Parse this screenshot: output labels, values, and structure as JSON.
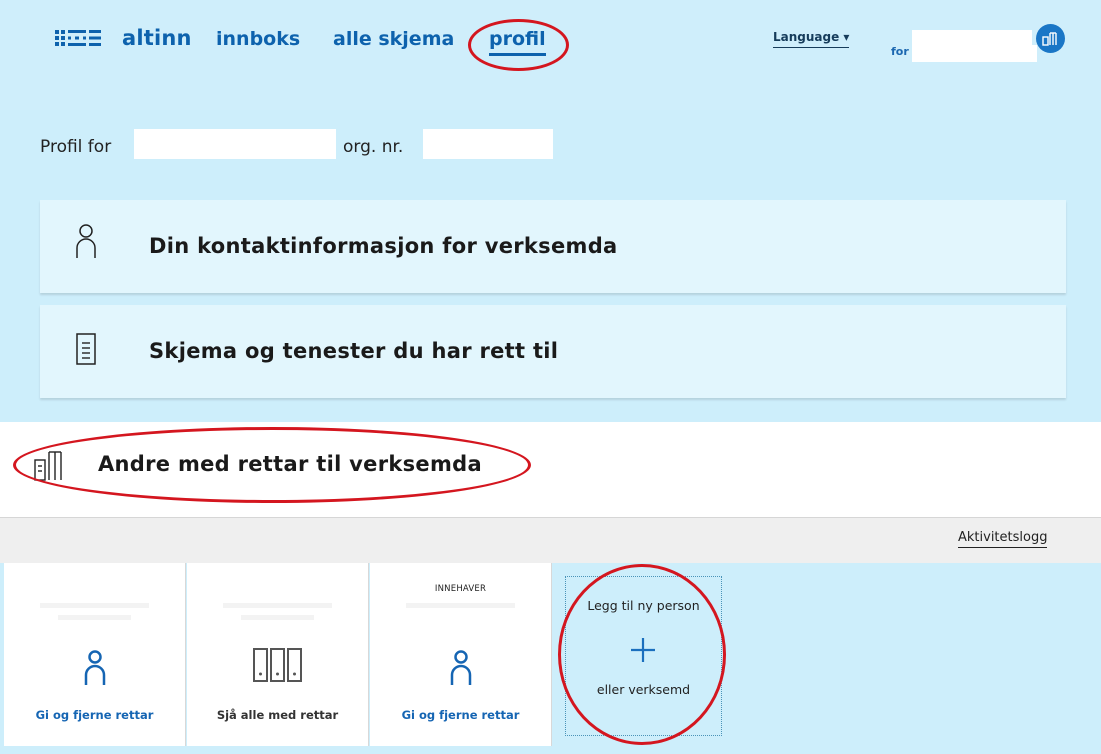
{
  "header": {
    "logo_text": "altinn",
    "nav": [
      {
        "label": "innboks"
      },
      {
        "label": "alle skjema"
      },
      {
        "label": "profil"
      }
    ],
    "language_label": "Language ▾",
    "for_label": "for"
  },
  "profile": {
    "prefix": "Profil for",
    "org_label": "org. nr."
  },
  "cards": [
    {
      "label": "Din kontaktinformasjon for verksemda",
      "icon": "person-icon"
    },
    {
      "label": "Skjema og tenester du har rett til",
      "icon": "document-icon"
    }
  ],
  "section": {
    "title": "Andre med rettar til verksemda",
    "icon": "building-icon"
  },
  "activity_link": "Aktivitetslogg",
  "tiles": [
    {
      "label": "Gi og fjerne rettar",
      "icon": "person-icon",
      "role": ""
    },
    {
      "label": "Sjå alle med rettar",
      "icon": "binders-icon",
      "role": ""
    },
    {
      "label": "Gi og fjerne rettar",
      "icon": "person-icon",
      "role": "INNEHAVER"
    }
  ],
  "add_tile": {
    "top_label": "Legg til ny person",
    "bottom_label": "eller verksemd",
    "icon": "plus-icon"
  },
  "colors": {
    "background": "#cdeefb",
    "brand_blue": "#0d62ad",
    "card_bg": "#e2f6fd",
    "annotation_red": "#d4161f"
  }
}
